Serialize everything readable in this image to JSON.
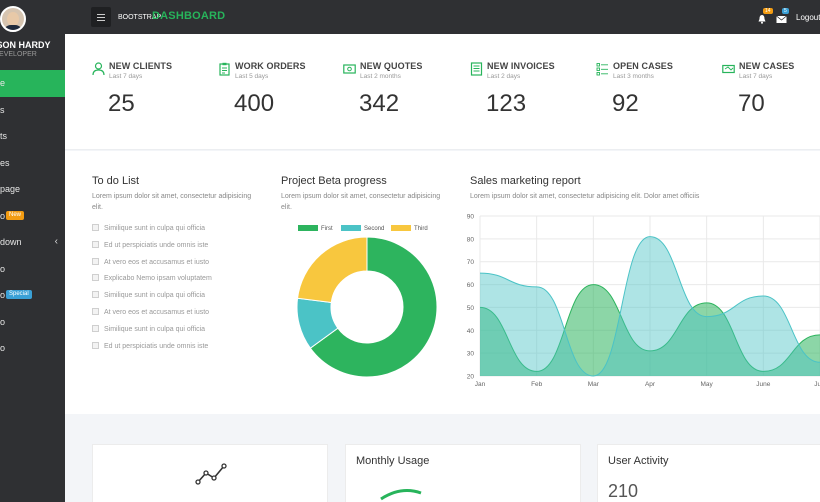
{
  "colors": {
    "accent": "#27b45b",
    "sidebar": "#2f3033",
    "teal": "#4bc3c6",
    "yellow": "#f8c73e",
    "orange_badge": "#f39c12",
    "blue_badge": "#3aa0d6"
  },
  "profile": {
    "name": "RSON HARDY",
    "role": "DEVELOPER"
  },
  "sidebar": {
    "items": [
      {
        "label": "e",
        "icon": "home-icon"
      },
      {
        "label": "s",
        "icon": "list-icon"
      },
      {
        "label": "ts",
        "icon": "chart-icon"
      },
      {
        "label": "es",
        "icon": "table-icon"
      },
      {
        "label": "page",
        "icon": "page-icon"
      },
      {
        "label": "o",
        "badge": "New",
        "icon": "star-icon"
      },
      {
        "label": "down",
        "icon": "dropdown-icon"
      },
      {
        "label": "o",
        "icon": "link-icon"
      },
      {
        "label": "o",
        "badge": "Special",
        "icon": "link-icon"
      },
      {
        "label": "o",
        "icon": "link-icon"
      },
      {
        "label": "o",
        "icon": "link-icon"
      }
    ]
  },
  "topbar": {
    "brand_small": "BOOTSTRAP",
    "brand_big": "DASHBOARD",
    "notif1_count": "14",
    "notif2_count": "5",
    "logout": "Logout"
  },
  "stats": [
    {
      "title": "NEW CLIENTS",
      "subtitle": "Last 7 days",
      "value": "25",
      "icon": "user-icon"
    },
    {
      "title": "WORK ORDERS",
      "subtitle": "Last 5 days",
      "value": "400",
      "icon": "clipboard-icon"
    },
    {
      "title": "NEW QUOTES",
      "subtitle": "Last 2 months",
      "value": "342",
      "icon": "quote-icon"
    },
    {
      "title": "NEW INVOICES",
      "subtitle": "Last 2 days",
      "value": "123",
      "icon": "invoice-icon"
    },
    {
      "title": "OPEN CASES",
      "subtitle": "Last 3 months",
      "value": "92",
      "icon": "checklist-icon"
    },
    {
      "title": "NEW CASES",
      "subtitle": "Last 7 days",
      "value": "70",
      "icon": "case-icon"
    }
  ],
  "todo": {
    "title": "To do List",
    "desc": "Lorem ipsum dolor sit amet, consectetur adipisicing elit.",
    "items": [
      "Similique sunt in culpa qui officia",
      "Ed ut perspiciatis unde omnis iste",
      "At vero eos et accusamus et iusto",
      "Explicabo Nemo ipsam voluptatem",
      "Similique sunt in culpa qui officia",
      "At vero eos et accusamus et iusto",
      "Similique sunt in culpa qui officia",
      "Ed ut perspiciatis unde omnis iste"
    ]
  },
  "progress": {
    "title": "Project Beta progress",
    "desc": "Lorem ipsum dolor sit amet, consectetur adipisicing elit.",
    "legend": [
      "First",
      "Second",
      "Third"
    ]
  },
  "sales": {
    "title": "Sales marketing report",
    "desc": "Lorem ipsum dolor sit amet, consectetur adipisicing elit. Dolor amet officiis"
  },
  "chart_data": [
    {
      "type": "pie",
      "donut": true,
      "labels": [
        "First",
        "Second",
        "Third"
      ],
      "values": [
        65,
        12,
        23
      ],
      "colors": [
        "#2db45e",
        "#4bc3c6",
        "#f8c73e"
      ]
    },
    {
      "type": "area",
      "categories": [
        "Jan",
        "Feb",
        "Mar",
        "Apr",
        "May",
        "June",
        "July"
      ],
      "ylim": [
        20,
        90
      ],
      "yticks": [
        20,
        30,
        40,
        50,
        60,
        70,
        80,
        90
      ],
      "grid": true,
      "series": [
        {
          "color": "#2db45e",
          "values": [
            50,
            22,
            60,
            31,
            52,
            22,
            38
          ]
        },
        {
          "color": "#4bc3c6",
          "values": [
            65,
            59,
            20,
            81,
            46,
            55,
            26
          ]
        }
      ]
    }
  ],
  "bottom": {
    "monthly_title": "Monthly Usage",
    "activity_title": "User Activity",
    "activity_value": "210"
  }
}
